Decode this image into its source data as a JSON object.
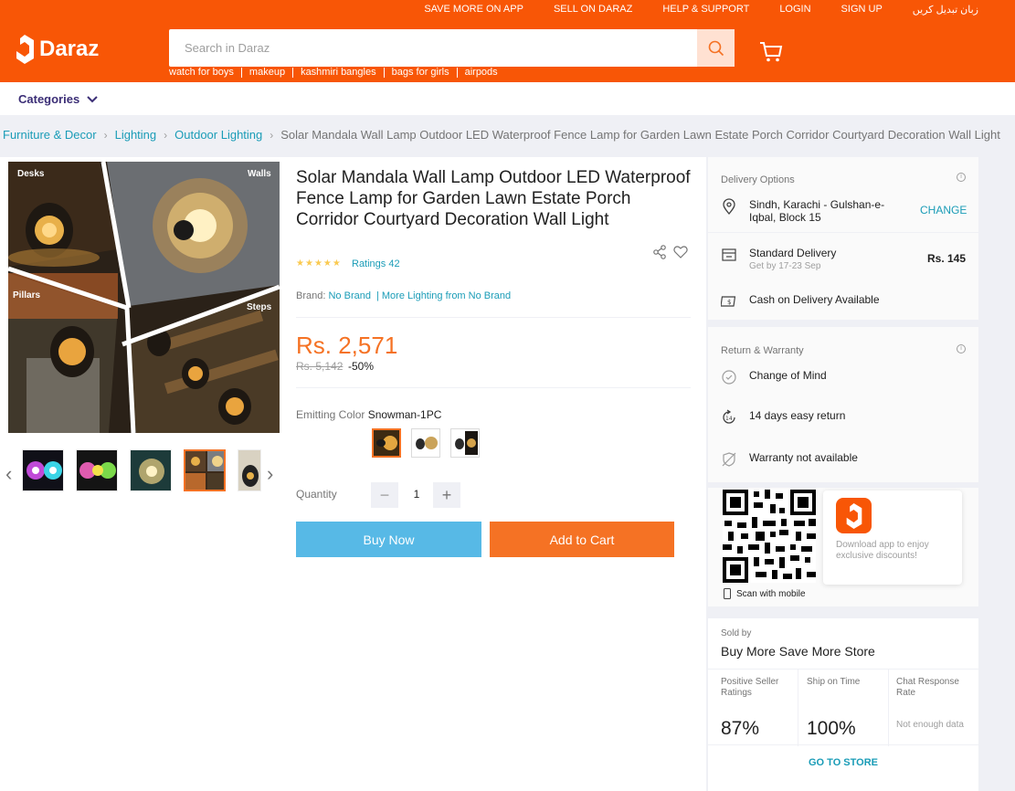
{
  "header": {
    "top_links": [
      "SAVE MORE ON APP",
      "SELL ON DARAZ",
      "HELP & SUPPORT",
      "LOGIN",
      "SIGN UP",
      "زبان تبدیل کریں"
    ],
    "logo_text": "Daraz",
    "search_placeholder": "Search in Daraz",
    "keywords": [
      "watch for boys",
      "makeup",
      "kashmiri bangles",
      "bags for girls",
      "airpods"
    ],
    "categories_label": "Categories"
  },
  "breadcrumb": {
    "links": [
      "Furniture & Decor",
      "Lighting",
      "Outdoor Lighting"
    ],
    "current": "Solar Mandala Wall Lamp Outdoor LED Waterproof Fence Lamp for Garden Lawn Estate Porch Corridor Courtyard Decoration Wall Light"
  },
  "gallery": {
    "labels": [
      "Desks",
      "Walls",
      "Pillars",
      "Steps"
    ]
  },
  "product": {
    "title": "Solar Mandala Wall Lamp Outdoor LED Waterproof Fence Lamp for Garden Lawn Estate Porch Corridor Courtyard Decoration Wall Light",
    "stars": 5,
    "ratings_text": "Ratings 42",
    "brand_label": "Brand:",
    "brand_name": "No Brand",
    "brand_more": "More Lighting from No Brand",
    "price": "Rs. 2,571",
    "old_price": "Rs. 5,142",
    "discount": "-50%",
    "color_label": "Emitting Color",
    "color_value": "Snowman-1PC",
    "quantity_label": "Quantity",
    "quantity": "1",
    "buy_now": "Buy Now",
    "add_to_cart": "Add to Cart"
  },
  "delivery": {
    "title": "Delivery Options",
    "location": "Sindh, Karachi - Gulshan-e-Iqbal, Block 15",
    "change": "CHANGE",
    "standard": "Standard Delivery",
    "get_by": "Get by 17-23 Sep",
    "fee": "Rs. 145",
    "cod": "Cash on Delivery Available"
  },
  "warranty": {
    "title": "Return & Warranty",
    "items": [
      "Change of Mind",
      "14 days easy return",
      "Warranty not available"
    ]
  },
  "app": {
    "promo": "Download app to enjoy exclusive discounts!",
    "scan": "Scan with mobile"
  },
  "seller": {
    "label": "Sold by",
    "name": "Buy More Save More Store",
    "stats": [
      {
        "label": "Positive Seller Ratings",
        "value": "87%"
      },
      {
        "label": "Ship on Time",
        "value": "100%"
      },
      {
        "label": "Chat Response Rate",
        "value": "Not enough data"
      }
    ],
    "go_to_store": "GO TO STORE"
  },
  "colors": {
    "brand": "#f85606",
    "accent": "#f57224",
    "buy_now": "#57b9e6",
    "link": "#1a9cb7"
  }
}
